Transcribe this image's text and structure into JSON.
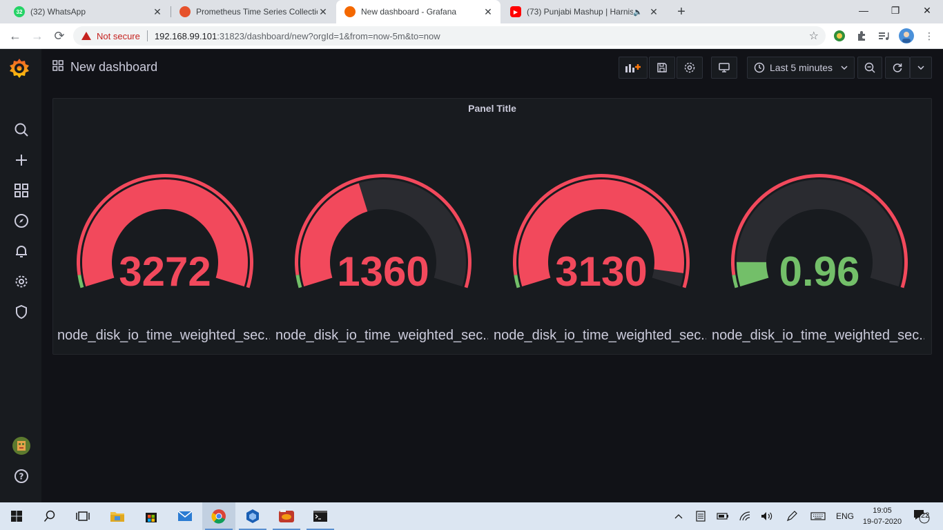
{
  "browser": {
    "tabs": [
      {
        "label": "(32) WhatsApp",
        "badge": "32",
        "icon": "whatsapp-icon"
      },
      {
        "label": "Prometheus Time Series Collectio",
        "icon": "prometheus-icon"
      },
      {
        "label": "New dashboard - Grafana",
        "icon": "grafana-icon",
        "active": true
      },
      {
        "label": "(73) Punjabi Mashup | Harnis",
        "icon": "youtube-icon",
        "audio": true
      }
    ],
    "security_label": "Not secure",
    "url_host": "192.168.99.101",
    "url_rest": ":31823/dashboard/new?orgId=1&from=now-5m&to=now"
  },
  "grafana": {
    "dashboard_title": "New dashboard",
    "time_range_label": "Last 5 minutes",
    "panel": {
      "title": "Panel Title",
      "gauges": [
        {
          "value": "3272",
          "fraction": 1.0,
          "color": "#f2495c",
          "name": "node_disk_io_time_weighted_sec..."
        },
        {
          "value": "1360",
          "fraction": 0.42,
          "color": "#f2495c",
          "name": "node_disk_io_time_weighted_sec..."
        },
        {
          "value": "3130",
          "fraction": 0.956,
          "color": "#f2495c",
          "name": "node_disk_io_time_weighted_sec..."
        },
        {
          "value": "0.96",
          "fraction": 0.08,
          "color": "#73bf69",
          "name": "node_disk_io_time_weighted_sec..."
        }
      ]
    },
    "colors": {
      "threshold_red": "#f2495c",
      "threshold_green": "#73bf69",
      "background": "#111217",
      "panel": "#181b1f"
    }
  },
  "taskbar": {
    "language": "ENG",
    "time": "19:05",
    "date": "19-07-2020",
    "notification_count": "22"
  }
}
